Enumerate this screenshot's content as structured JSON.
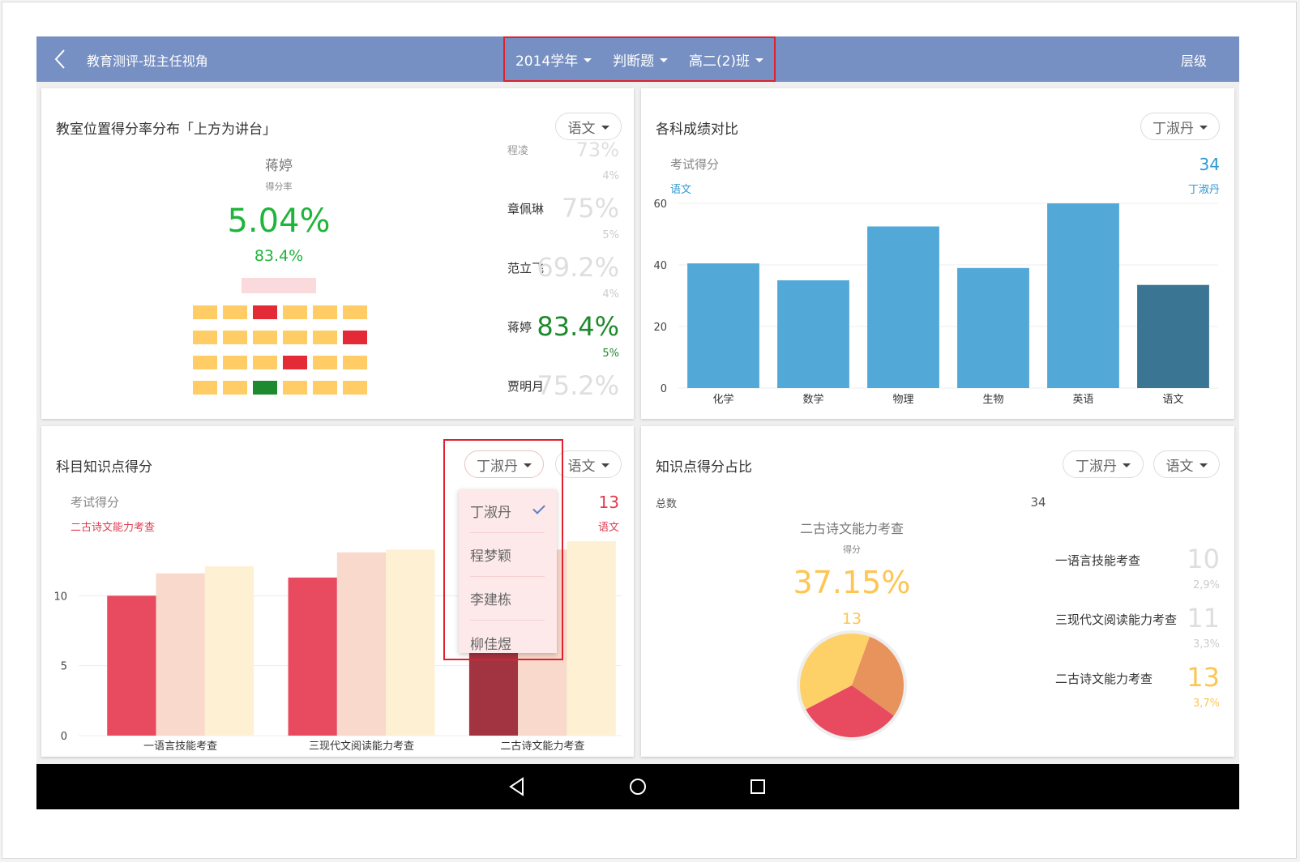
{
  "header": {
    "title": "教育测评-班主任视角",
    "filters": [
      {
        "label": "2014学年"
      },
      {
        "label": "判断题"
      },
      {
        "label": "高二(2)班"
      }
    ],
    "level_label": "层级"
  },
  "seat_card": {
    "title": "教室位置得分率分布「上方为讲台」",
    "subject_chip": "语文",
    "selected": {
      "name": "蒋婷",
      "rate_label": "得分率",
      "big_value": "5.04%",
      "sub_value": "83.4%"
    },
    "seat_grid": [
      [
        "y",
        "y",
        "r",
        "y",
        "y",
        "y"
      ],
      [
        "y",
        "y",
        "y",
        "y",
        "y",
        "r"
      ],
      [
        "y",
        "y",
        "y",
        "r",
        "y",
        "y"
      ],
      [
        "y",
        "y",
        "g",
        "y",
        "y",
        "y"
      ]
    ],
    "students": [
      {
        "name": "程凌",
        "value": "73%",
        "sub": "4%"
      },
      {
        "name": "章佩琳",
        "value": "75%",
        "sub": "5%"
      },
      {
        "name": "范立飞",
        "value": "69.2%",
        "sub": "4%"
      },
      {
        "name": "蒋婷",
        "value": "83.4%",
        "sub": "5%"
      },
      {
        "name": "贾明月",
        "value": "75.2%",
        "sub": ""
      }
    ]
  },
  "subject_card": {
    "title": "各科成绩对比",
    "student_chip": "丁淑丹",
    "score_label": "考试得分",
    "subject_label": "语文",
    "score_value": "34",
    "student_name": "丁淑丹",
    "chart_data": {
      "type": "bar",
      "categories": [
        "化学",
        "数学",
        "物理",
        "生物",
        "英语",
        "语文"
      ],
      "values": [
        40.5,
        35,
        52.5,
        39,
        60,
        33.5
      ],
      "highlight": "语文",
      "ylim": [
        0,
        60
      ],
      "yticks": [
        0,
        20,
        40,
        60
      ],
      "colors": {
        "bar": "#52a9d8",
        "highlight": "#3a7594"
      }
    }
  },
  "knowledge_card": {
    "title": "科目知识点得分",
    "student_chip": "丁淑丹",
    "subject_chip": "语文",
    "score_label": "考试得分",
    "point_label": "二古诗文能力考查",
    "score_value": "13",
    "subject_label": "语文",
    "dropdown": {
      "options": [
        "丁淑丹",
        "程梦颖",
        "李建栋",
        "柳佳煜"
      ],
      "selected": "丁淑丹"
    },
    "chart_data": {
      "type": "bar",
      "categories": [
        "一语言技能考查",
        "三现代文阅读能力考查",
        "二古诗文能力考查"
      ],
      "series": [
        {
          "values": [
            10,
            11.3,
            13
          ]
        },
        {
          "values": [
            11.6,
            13.1,
            13.3
          ]
        },
        {
          "values": [
            12.1,
            13.3,
            13.9
          ]
        }
      ],
      "ylim": [
        0,
        13.9
      ],
      "yticks": [
        0,
        5,
        10
      ],
      "colors": [
        "#e84a5f",
        "#f8d9cc",
        "#fef0d2"
      ],
      "highlight_color": "#a23442"
    }
  },
  "ratio_card": {
    "title": "知识点得分占比",
    "student_chip": "丁淑丹",
    "subject_chip": "语文",
    "total_label": "总数",
    "total_value": "34",
    "center_title": "二古诗文能力考查",
    "center_sub": "得分",
    "center_percent": "37.15%",
    "center_value": "13",
    "points": [
      {
        "name": "一语言技能考查",
        "value": "10",
        "sub": "2,9%"
      },
      {
        "name": "三现代文阅读能力考查",
        "value": "11",
        "sub": "3,3%"
      },
      {
        "name": "二古诗文能力考查",
        "value": "13",
        "sub": "3,7%"
      }
    ],
    "chart_data": {
      "type": "pie",
      "labels": [
        "一语言技能考查",
        "三现代文阅读能力考查",
        "二古诗文能力考查"
      ],
      "values": [
        10,
        11,
        13
      ],
      "colors": [
        "#e8925c",
        "#e84a5f",
        "#fed068"
      ]
    }
  }
}
